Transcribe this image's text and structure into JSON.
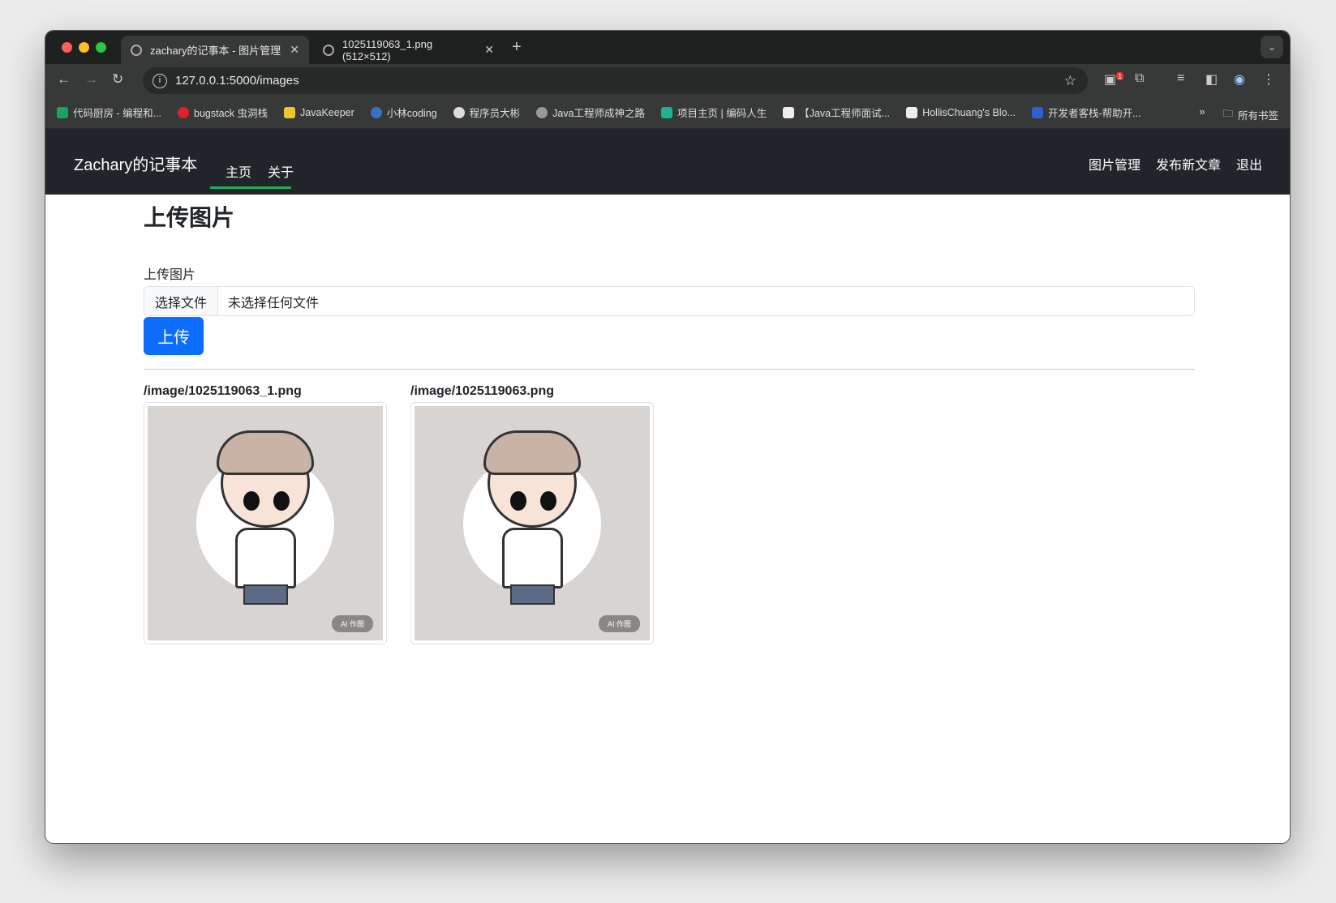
{
  "browser": {
    "tabs": [
      {
        "title": "zachary的记事本 - 图片管理",
        "active": true
      },
      {
        "title": "1025119063_1.png (512×512)",
        "active": false
      }
    ],
    "url": "127.0.0.1:5000/images",
    "extension_badge": "1",
    "bookmarks": [
      {
        "label": "代码厨房 - 编程和...",
        "color": "#1aa260"
      },
      {
        "label": "bugstack 虫洞栈",
        "color": "#e0202a"
      },
      {
        "label": "JavaKeeper",
        "color": "#f2c230"
      },
      {
        "label": "小林coding",
        "color": "#3a6fc9"
      },
      {
        "label": "程序员大彬",
        "color": "#ddd"
      },
      {
        "label": "Java工程师成神之路",
        "color": "#999"
      },
      {
        "label": "项目主页 | 编码人生",
        "color": "#1ab394"
      },
      {
        "label": "【Java工程师面试...",
        "color": "#eee"
      },
      {
        "label": "HollisChuang's Blo...",
        "color": "#eee"
      },
      {
        "label": "开发者客栈-帮助开...",
        "color": "#2f5fd0"
      }
    ],
    "all_bookmarks": "所有书签"
  },
  "navbar": {
    "brand": "Zachary的记事本",
    "links": [
      "主页",
      "关于"
    ],
    "right": [
      "图片管理",
      "发布新文章",
      "退出"
    ],
    "accent": "#14b35a"
  },
  "main": {
    "title": "上传图片",
    "field_label": "上传图片",
    "file_button": "选择文件",
    "file_status": "未选择任何文件",
    "upload_button": "上传",
    "images": [
      {
        "path": "/image/1025119063_1.png",
        "badge": "AI 作图"
      },
      {
        "path": "/image/1025119063.png",
        "badge": "AI 作图"
      }
    ]
  }
}
